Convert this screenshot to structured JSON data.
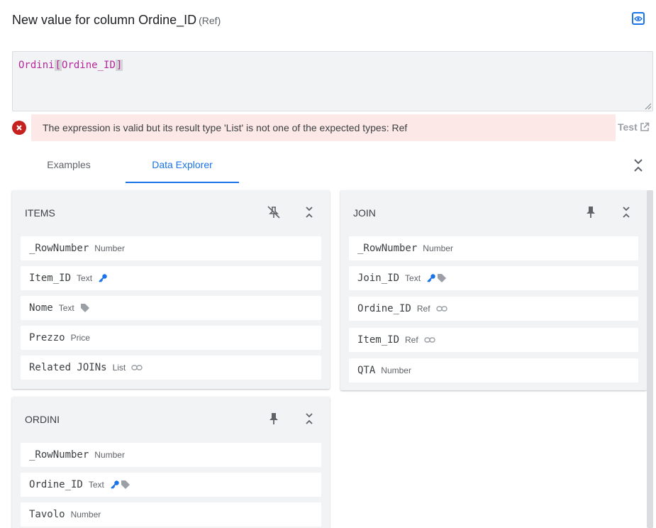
{
  "header": {
    "title": "New value for column Ordine_ID",
    "subtitle": "(Ref)"
  },
  "editor": {
    "table": "Ordini",
    "open_bracket": "[",
    "column": "Ordine_ID",
    "close_bracket": "]"
  },
  "error": {
    "message": "The expression is valid but its result type 'List' is not one of the expected types: Ref",
    "test_label": "Test"
  },
  "tabs": [
    {
      "label": "Examples"
    },
    {
      "label": "Data Explorer"
    }
  ],
  "tables": {
    "items": {
      "name": "ITEMS",
      "rows": [
        {
          "name": "_RowNumber",
          "type": "Number"
        },
        {
          "name": "Item_ID",
          "type": "Text"
        },
        {
          "name": "Nome",
          "type": "Text"
        },
        {
          "name": "Prezzo",
          "type": "Price"
        },
        {
          "name": "Related JOINs",
          "type": "List"
        }
      ]
    },
    "join": {
      "name": "JOIN",
      "rows": [
        {
          "name": "_RowNumber",
          "type": "Number"
        },
        {
          "name": "Join_ID",
          "type": "Text"
        },
        {
          "name": "Ordine_ID",
          "type": "Ref"
        },
        {
          "name": "Item_ID",
          "type": "Ref"
        },
        {
          "name": "QTA",
          "type": "Number"
        }
      ]
    },
    "ordini": {
      "name": "ORDINI",
      "rows": [
        {
          "name": "_RowNumber",
          "type": "Number"
        },
        {
          "name": "Ordine_ID",
          "type": "Text"
        },
        {
          "name": "Tavolo",
          "type": "Number"
        }
      ]
    }
  },
  "colors": {
    "accent": "#1a73e8",
    "error": "#c5221f",
    "error_bg": "#fce8e6",
    "expression_token": "#b5289b"
  }
}
